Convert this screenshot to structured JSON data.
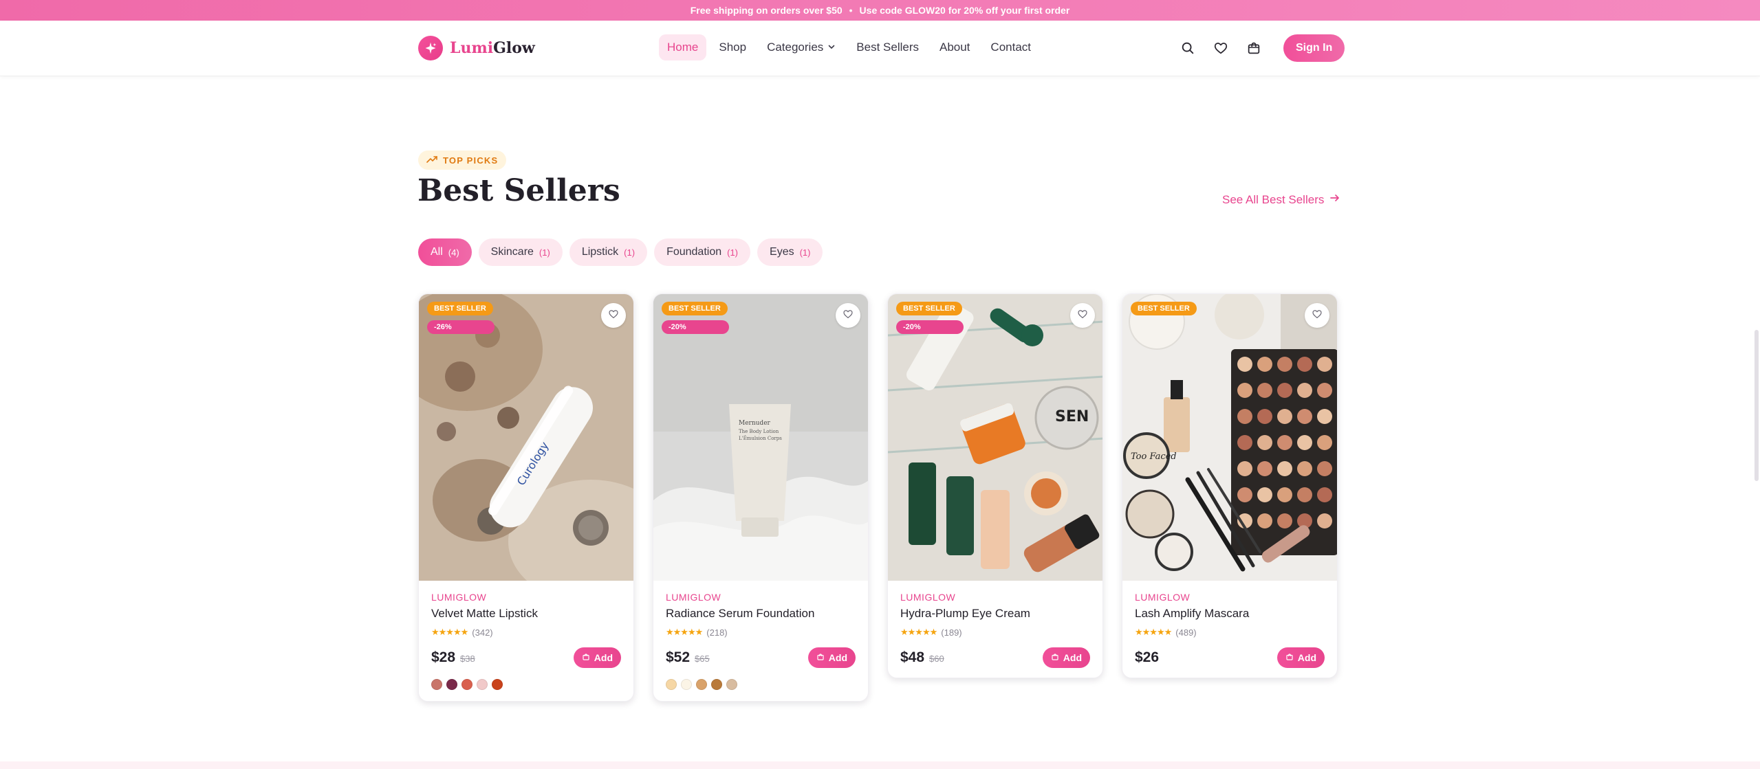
{
  "announcement": {
    "text1": "Free shipping on orders over $50",
    "sep": "•",
    "text2": "Use code",
    "code": "GLOW20",
    "text3": "for 20% off your first order"
  },
  "header": {
    "logo": {
      "lumi": "Lumi",
      "glow": "Glow",
      "icon": "sparkle-icon"
    },
    "nav": [
      {
        "label": "Home",
        "active": true
      },
      {
        "label": "Shop"
      },
      {
        "label": "Categories",
        "icon": "chevron-down-icon"
      },
      {
        "label": "Best Sellers"
      },
      {
        "label": "About"
      },
      {
        "label": "Contact"
      }
    ],
    "actions": {
      "search_icon": "search-icon",
      "wishlist_icon": "heart-icon",
      "cart_icon": "shopping-bag-icon",
      "signin": "Sign In"
    }
  },
  "section": {
    "badge": "TOP PICKS",
    "title": "Best Sellers",
    "see_all": "See All Best Sellers",
    "filters": [
      {
        "label": "All",
        "count": "(4)",
        "active": true
      },
      {
        "label": "Skincare",
        "count": "(1)"
      },
      {
        "label": "Lipstick",
        "count": "(1)"
      },
      {
        "label": "Foundation",
        "count": "(1)"
      },
      {
        "label": "Eyes",
        "count": "(1)"
      }
    ]
  },
  "products": [
    {
      "badge": "BEST SELLER",
      "discount": "-26%",
      "brand": "LUMIGLOW",
      "name": "Velvet Matte Lipstick",
      "stars": "★★★★★",
      "reviews": "(342)",
      "price": "$28",
      "old_price": "$38",
      "add": "Add",
      "swatches": [
        "#c9756a",
        "#7a2a4a",
        "#d9604e",
        "#f1c9c9",
        "#c9431c"
      ]
    },
    {
      "badge": "BEST SELLER",
      "discount": "-20%",
      "brand": "LUMIGLOW",
      "name": "Radiance Serum Foundation",
      "stars": "★★★★★",
      "reviews": "(218)",
      "price": "$52",
      "old_price": "$65",
      "add": "Add",
      "swatches": [
        "#f6d7a5",
        "#fbf4e6",
        "#d9a26a",
        "#b97a3a",
        "#d8bca0"
      ]
    },
    {
      "badge": "BEST SELLER",
      "discount": "-20%",
      "brand": "LUMIGLOW",
      "name": "Hydra-Plump Eye Cream",
      "stars": "★★★★★",
      "reviews": "(189)",
      "price": "$48",
      "old_price": "$60",
      "add": "Add",
      "swatches": []
    },
    {
      "badge": "BEST SELLER",
      "discount": "",
      "brand": "LUMIGLOW",
      "name": "Lash Amplify Mascara",
      "stars": "★★★★★",
      "reviews": "(489)",
      "price": "$26",
      "old_price": "",
      "add": "Add",
      "swatches": []
    }
  ]
}
